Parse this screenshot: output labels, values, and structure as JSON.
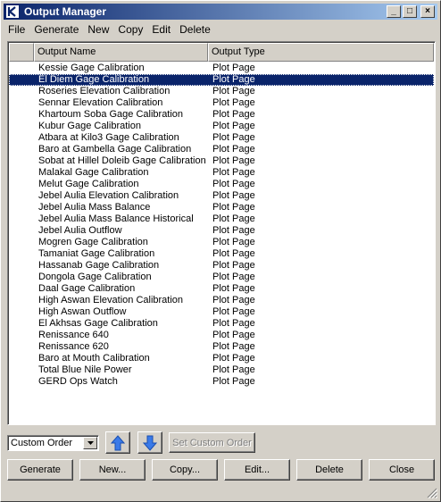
{
  "window": {
    "title": "Output Manager",
    "minimize": "_",
    "maximize": "□",
    "close": "×"
  },
  "menu": [
    "File",
    "Generate",
    "New",
    "Copy",
    "Edit",
    "Delete"
  ],
  "table": {
    "headers": {
      "name": "Output Name",
      "type": "Output Type"
    },
    "rows": [
      {
        "name": "Kessie Gage Calibration",
        "type": "Plot Page",
        "selected": false
      },
      {
        "name": "El Diem Gage Calibration",
        "type": "Plot Page",
        "selected": true
      },
      {
        "name": "Roseries Elevation Calibration",
        "type": "Plot Page",
        "selected": false
      },
      {
        "name": "Sennar Elevation Calibration",
        "type": "Plot Page",
        "selected": false
      },
      {
        "name": "Khartoum Soba Gage Calibration",
        "type": "Plot Page",
        "selected": false
      },
      {
        "name": "Kubur Gage Calibration",
        "type": "Plot Page",
        "selected": false
      },
      {
        "name": "Atbara at Kilo3 Gage Calibration",
        "type": "Plot Page",
        "selected": false
      },
      {
        "name": "Baro at Gambella Gage Calibration",
        "type": "Plot Page",
        "selected": false
      },
      {
        "name": "Sobat at Hillel Doleib Gage Calibration",
        "type": "Plot Page",
        "selected": false
      },
      {
        "name": "Malakal Gage Calibration",
        "type": "Plot Page",
        "selected": false
      },
      {
        "name": "Melut Gage Calibration",
        "type": "Plot Page",
        "selected": false
      },
      {
        "name": "Jebel Aulia Elevation Calibration",
        "type": "Plot Page",
        "selected": false
      },
      {
        "name": "Jebel Aulia Mass Balance",
        "type": "Plot Page",
        "selected": false
      },
      {
        "name": "Jebel Aulia Mass Balance  Historical",
        "type": "Plot Page",
        "selected": false
      },
      {
        "name": "Jebel Aulia Outflow",
        "type": "Plot Page",
        "selected": false
      },
      {
        "name": "Mogren Gage Calibration",
        "type": "Plot Page",
        "selected": false
      },
      {
        "name": "Tamaniat Gage Calibration",
        "type": "Plot Page",
        "selected": false
      },
      {
        "name": "Hassanab Gage Calibration",
        "type": "Plot Page",
        "selected": false
      },
      {
        "name": "Dongola Gage Calibration",
        "type": "Plot Page",
        "selected": false
      },
      {
        "name": "Daal Gage Calibration",
        "type": "Plot Page",
        "selected": false
      },
      {
        "name": "High Aswan Elevation Calibration",
        "type": "Plot Page",
        "selected": false
      },
      {
        "name": "High Aswan Outflow",
        "type": "Plot Page",
        "selected": false
      },
      {
        "name": "El Akhsas Gage Calibration",
        "type": "Plot Page",
        "selected": false
      },
      {
        "name": "Renissance 640",
        "type": "Plot Page",
        "selected": false
      },
      {
        "name": "Renissance 620",
        "type": "Plot Page",
        "selected": false
      },
      {
        "name": "Baro at Mouth Calibration",
        "type": "Plot Page",
        "selected": false
      },
      {
        "name": "Total Blue Nile Power",
        "type": "Plot Page",
        "selected": false
      },
      {
        "name": "GERD Ops Watch",
        "type": "Plot Page",
        "selected": false
      }
    ]
  },
  "order": {
    "selected": "Custom Order",
    "move_up_icon": "arrow-up-icon",
    "move_down_icon": "arrow-down-icon",
    "set_custom_order": "Set Custom Order"
  },
  "buttons": {
    "generate": "Generate",
    "new": "New...",
    "copy": "Copy...",
    "edit": "Edit...",
    "delete": "Delete",
    "close": "Close"
  },
  "colors": {
    "titlebar": "#0a246a",
    "selection": "#0a246a",
    "arrow": "#3a7ae8"
  }
}
